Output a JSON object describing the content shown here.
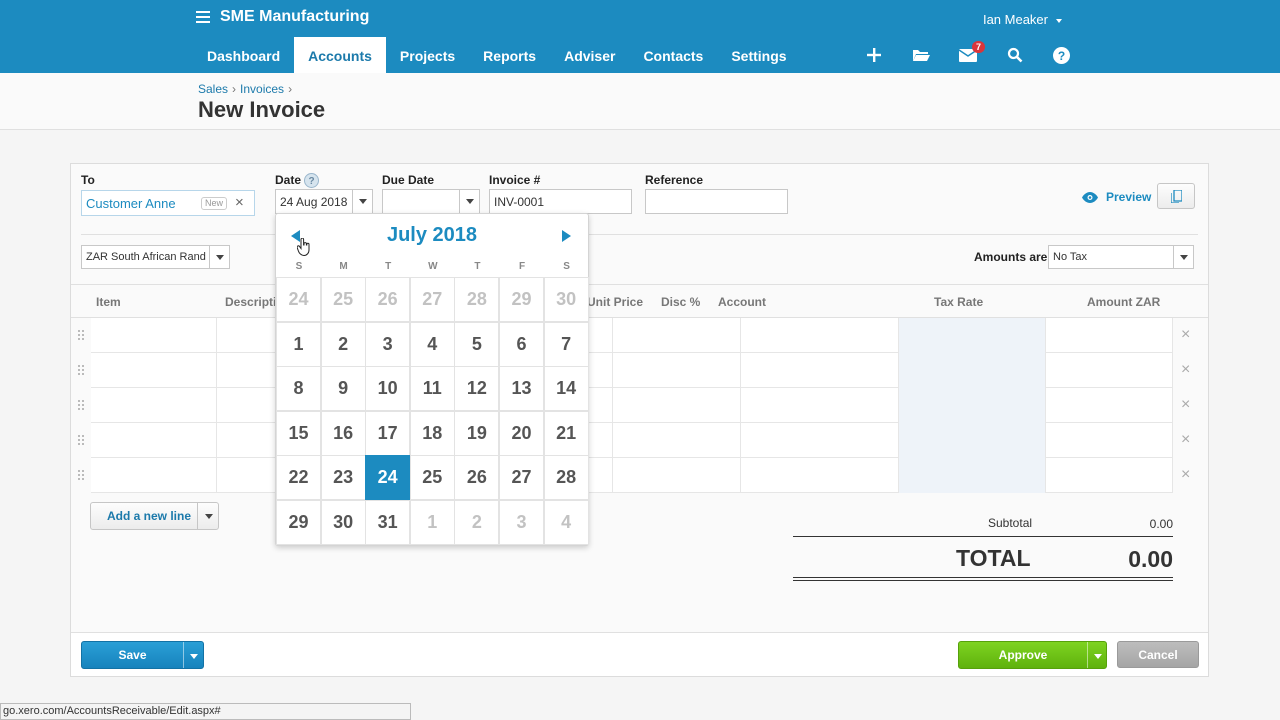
{
  "header": {
    "org_name": "SME Manufacturing",
    "user_name": "Ian Meaker",
    "nav": [
      {
        "label": "Dashboard",
        "active": false
      },
      {
        "label": "Accounts",
        "active": true
      },
      {
        "label": "Projects",
        "active": false
      },
      {
        "label": "Reports",
        "active": false
      },
      {
        "label": "Adviser",
        "active": false
      },
      {
        "label": "Contacts",
        "active": false
      },
      {
        "label": "Settings",
        "active": false
      }
    ],
    "icons": [
      "plus-icon",
      "folder-icon",
      "mail-icon",
      "search-icon",
      "help-icon"
    ],
    "mail_badge": "7",
    "accent_color": "#1c8bc0"
  },
  "breadcrumb": {
    "items": [
      "Sales",
      "Invoices"
    ],
    "separator": "›"
  },
  "page_title": "New Invoice",
  "form": {
    "to_label": "To",
    "to_value": "Customer Anne",
    "to_new_tag": "New",
    "date_label": "Date",
    "date_help": "?",
    "date_value": "24 Aug 2018",
    "due_date_label": "Due Date",
    "due_date_value": "",
    "invoice_label": "Invoice #",
    "invoice_value": "INV-0001",
    "reference_label": "Reference",
    "reference_value": "",
    "preview_label": "Preview",
    "currency_value": "ZAR South African Rand",
    "amounts_label": "Amounts are",
    "amounts_value": "No Tax"
  },
  "table": {
    "columns": [
      "Item",
      "Descriptio",
      "Unit Price",
      "Disc %",
      "Account",
      "Tax Rate",
      "Amount ZAR"
    ],
    "row_count": 5,
    "add_line_label": "Add a new line"
  },
  "totals": {
    "subtotal_label": "Subtotal",
    "subtotal_value": "0.00",
    "total_label": "TOTAL",
    "total_value": "0.00"
  },
  "buttons": {
    "save": "Save",
    "approve": "Approve",
    "cancel": "Cancel"
  },
  "calendar": {
    "title": "July 2018",
    "weekdays": [
      "S",
      "M",
      "T",
      "W",
      "T",
      "F",
      "S"
    ],
    "weeks": [
      [
        {
          "d": "24",
          "m": true
        },
        {
          "d": "25",
          "m": true
        },
        {
          "d": "26",
          "m": true
        },
        {
          "d": "27",
          "m": true
        },
        {
          "d": "28",
          "m": true
        },
        {
          "d": "29",
          "m": true
        },
        {
          "d": "30",
          "m": true
        }
      ],
      [
        {
          "d": "1"
        },
        {
          "d": "2"
        },
        {
          "d": "3"
        },
        {
          "d": "4"
        },
        {
          "d": "5"
        },
        {
          "d": "6"
        },
        {
          "d": "7"
        }
      ],
      [
        {
          "d": "8"
        },
        {
          "d": "9"
        },
        {
          "d": "10"
        },
        {
          "d": "11"
        },
        {
          "d": "12"
        },
        {
          "d": "13"
        },
        {
          "d": "14"
        }
      ],
      [
        {
          "d": "15"
        },
        {
          "d": "16"
        },
        {
          "d": "17"
        },
        {
          "d": "18"
        },
        {
          "d": "19"
        },
        {
          "d": "20"
        },
        {
          "d": "21"
        }
      ],
      [
        {
          "d": "22"
        },
        {
          "d": "23"
        },
        {
          "d": "24",
          "s": true
        },
        {
          "d": "25"
        },
        {
          "d": "26"
        },
        {
          "d": "27"
        },
        {
          "d": "28"
        }
      ],
      [
        {
          "d": "29"
        },
        {
          "d": "30"
        },
        {
          "d": "31"
        },
        {
          "d": "1",
          "m": true
        },
        {
          "d": "2",
          "m": true
        },
        {
          "d": "3",
          "m": true
        },
        {
          "d": "4",
          "m": true
        }
      ]
    ]
  },
  "statusbar": {
    "url": "go.xero.com/AccountsReceivable/Edit.aspx#"
  }
}
